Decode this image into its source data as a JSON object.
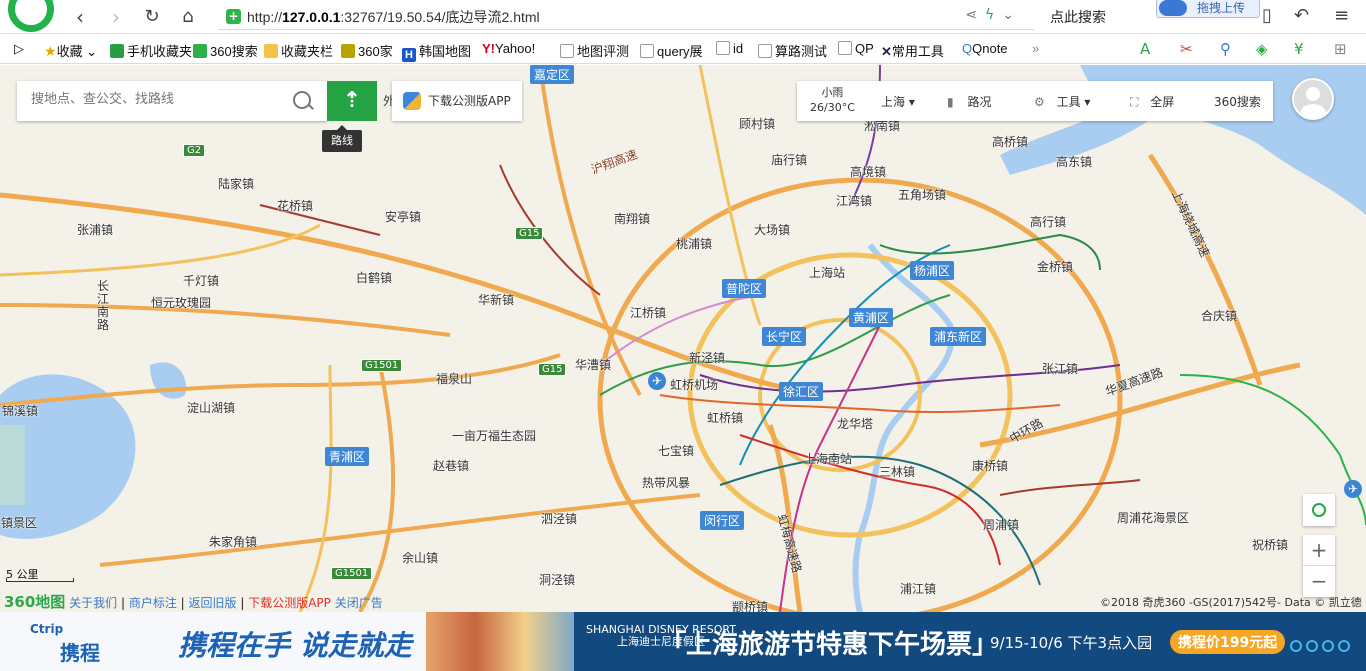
{
  "browser": {
    "url_prefix": "http://",
    "url_host": "127.0.0.1",
    "url_rest": ":32767/19.50.54/底边导流2.html",
    "search_click": "点此搜索",
    "drag_upload": "拖拽上传"
  },
  "bookmarks": [
    {
      "label": "收藏",
      "icon": "star-icon"
    },
    {
      "label": "手机收藏夹",
      "icon": "phone-icon"
    },
    {
      "label": "360搜索",
      "icon": "search-360-icon"
    },
    {
      "label": "收藏夹栏",
      "icon": "folder-icon"
    },
    {
      "label": "360家",
      "icon": "home-360-icon"
    },
    {
      "label": "韩国地图",
      "icon": "h-icon"
    },
    {
      "label": "Yahoo!",
      "icon": "yahoo-icon"
    },
    {
      "label": "地图评测",
      "icon": "page-icon"
    },
    {
      "label": "query展",
      "icon": "page-icon"
    },
    {
      "label": "id",
      "icon": "page-icon"
    },
    {
      "label": "算路测试",
      "icon": "page-icon"
    },
    {
      "label": "QP",
      "icon": "page-icon"
    },
    {
      "label": "常用工具",
      "icon": "tools-icon"
    },
    {
      "label": "Qnote",
      "icon": "qnote-icon"
    }
  ],
  "map_ui": {
    "search_placeholder": "搜地点、查公交、找路线",
    "route_tip": "路线",
    "app_download": "下载公测版APP",
    "weather_cond": "小雨",
    "weather_temp": "26/30°C",
    "city": "上海",
    "traffic": "路况",
    "tools": "工具",
    "fullscreen": "全屏",
    "search360": "360搜索",
    "scale": "5 公里",
    "copyright": "©2018 奇虎360 -GS(2017)542号- Data © 凯立德"
  },
  "footer": {
    "brand": "360地图",
    "links": [
      "关于我们",
      "商户标注",
      "返回旧版",
      "下载公测版APP",
      "关闭广告"
    ]
  },
  "ad": {
    "ctrip_en": "Ctrip",
    "ctrip_cn": "携程",
    "slogan": "携程在手  说走就走",
    "disney": "SHANGHAI DISNEY RESORT",
    "disney_cn": "上海迪士尼度假区",
    "title": "「上海旅游节特惠下午场票」",
    "dates": "9/15-10/6  下午3点入园",
    "price": "携程价199元起"
  },
  "districts": [
    "嘉定区",
    "普陀区",
    "长宁区",
    "黄浦区",
    "杨浦区",
    "浦东新区",
    "徐汇区",
    "青浦区",
    "闵行区"
  ],
  "places": [
    "陆家镇",
    "花桥镇",
    "安亭镇",
    "张浦镇",
    "千灯镇",
    "恒元玫瑰园",
    "白鹤镇",
    "华新镇",
    "南翔镇",
    "桃浦镇",
    "大场镇",
    "顾村镇",
    "庙行镇",
    "高境镇",
    "江湾镇",
    "五角场镇",
    "高桥镇",
    "高东镇",
    "高行镇",
    "金桥镇",
    "合庆镇",
    "张江镇",
    "上海站",
    "福泉山",
    "华漕镇",
    "江桥镇",
    "新泾镇",
    "虹桥机场",
    "虹桥镇",
    "龙华塔",
    "上海南站",
    "三林镇",
    "康桥镇",
    "周浦镇",
    "周浦花海景区",
    "祝桥镇",
    "锦溪镇",
    "淀山湖镇",
    "一亩万福生态园",
    "赵巷镇",
    "七宝镇",
    "热带风暴",
    "泗泾镇",
    "余山镇",
    "洞泾镇",
    "朱家角镇",
    "镇景区",
    "浦江镇",
    "颛桥镇",
    "长江南路",
    "沪翔高速",
    "华夏高速路",
    "中环路",
    "上海绕城高速",
    "虹梅高速路",
    "淞南镇",
    "外"
  ],
  "highways": [
    "G2",
    "G15",
    "G15",
    "G1501",
    "G1501"
  ]
}
